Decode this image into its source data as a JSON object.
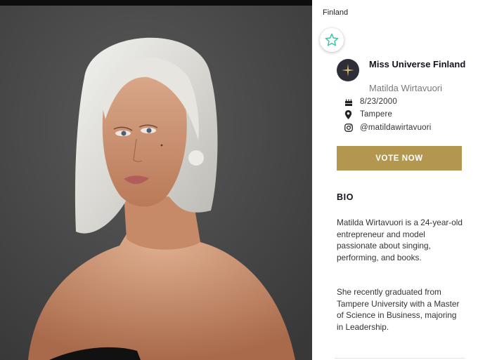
{
  "photo": {
    "alt": ""
  },
  "profile": {
    "country": "Finland",
    "title": "Miss Universe Finland",
    "name": "Matilda Wirtavuori",
    "birthdate": "8/23/2000",
    "city": "Tampere",
    "instagram": "@matildawirtavuori"
  },
  "icons": {
    "favorite": "star-outline-icon",
    "emblem": "sparkle-star-icon",
    "birthdate": "cake-icon",
    "city": "location-pin-icon",
    "instagram": "instagram-icon"
  },
  "actions": {
    "vote_label": "VOTE NOW"
  },
  "bio": {
    "heading": "BIO",
    "paragraphs": [
      "Matilda Wirtavuori is a 24-year-old entrepreneur and model passionate about singing, performing, and books.",
      "She recently graduated from Tampere University with a Master of Science in Business, majoring in Leadership."
    ]
  },
  "colors": {
    "accent": "#b3974f",
    "favorite_icon": "#3cc7a6",
    "emblem_bg": "#2e2e39",
    "photo_bg": "#4a4a4a"
  }
}
